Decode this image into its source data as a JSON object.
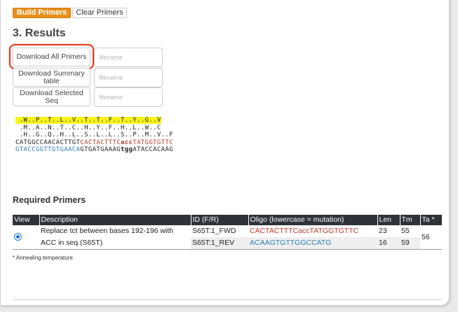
{
  "toolbar": {
    "build_label": "Build Primers",
    "clear_label": "Clear Primers"
  },
  "results": {
    "title": "3. Results",
    "download_all_label": "Download All Primers",
    "download_summary_label": "Download Summary table",
    "download_selected_label": "Download Selected Seq",
    "filename_placeholder": "filename"
  },
  "sequence": {
    "frame1": " .W..P..T..L..V..T..T..F..T..Y..G..V",
    "frame2": " .M..A..N..T..C..H..Y..F..H..L..W..C",
    "frame3": " .H..G..Q..H..L..S..L..L..S..P..M..V..F",
    "fwd_black": "CATGGCCAACACTTGT",
    "fwd_red_a": "CACTACTTTC",
    "fwd_mut": "acc",
    "fwd_red_b": "TATGGTGTTC",
    "rev_blue": "GTACCGGTTGTGAACA",
    "rev_black_a": "GTGATGAAAG",
    "rev_bold": "tgg",
    "rev_black_b": "ATACCACAAG"
  },
  "primers": {
    "title": "Required Primers",
    "headers": [
      "View",
      "Description",
      "ID (F/R)",
      "Oligo (lowercase = mutation)",
      "Len",
      "Tm",
      "Ta *"
    ],
    "description": "Replace tct between bases 192-196 with ACC in seq (S65T)",
    "rows": [
      {
        "id": "S65T:1_FWD",
        "oligo": "CACTACTTTCaccTATGGTGTTC",
        "len": "23",
        "tm": "55"
      },
      {
        "id": "S65T:1_REV",
        "oligo": "ACAAGTGTTGGCCATG",
        "len": "16",
        "tm": "59"
      }
    ],
    "ta": "56",
    "note": "* Annealing temperature"
  },
  "colors": {
    "accent": "#e8901a",
    "highlight": "#e03a1e",
    "forward": "#c0392b",
    "reverse": "#2e7fb3",
    "frame_highlight": "#f7f31a"
  }
}
